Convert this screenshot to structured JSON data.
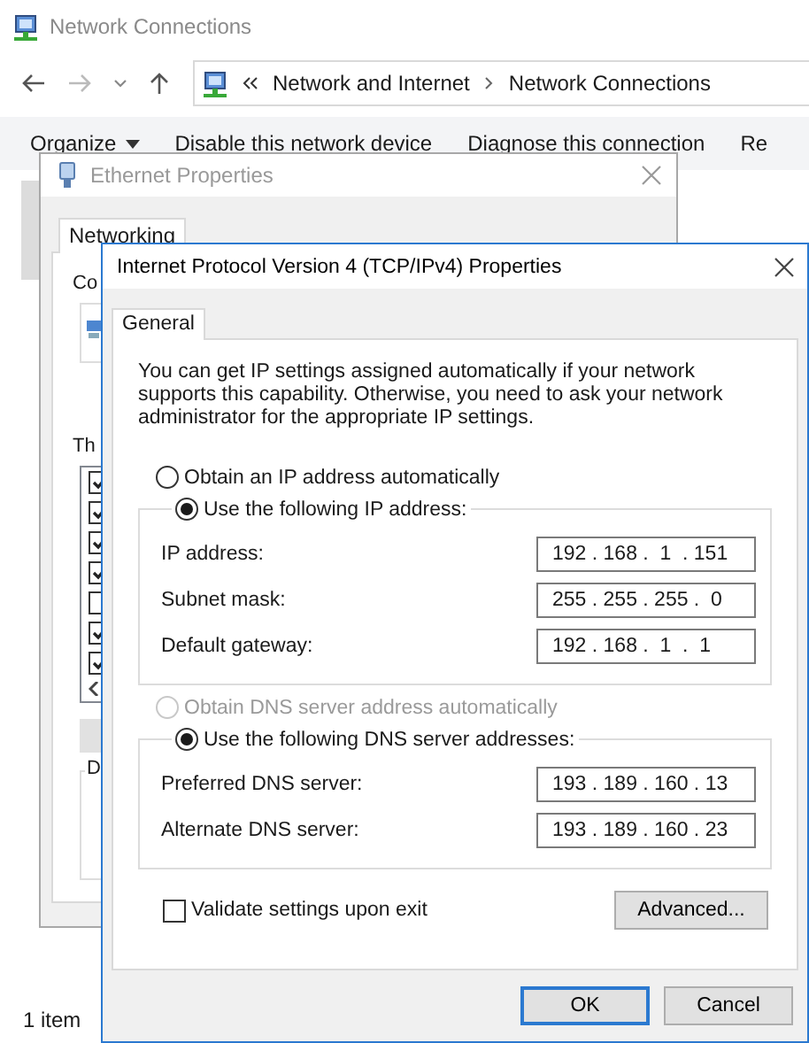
{
  "explorer": {
    "title": "Network Connections",
    "breadcrumb": [
      "Network and Internet",
      "Network Connections"
    ],
    "toolbar": [
      {
        "label": "Organize",
        "kind": "menu"
      },
      {
        "label": "Disable this network device",
        "kind": "button"
      },
      {
        "label": "Diagnose this connection",
        "kind": "button"
      },
      {
        "label": "Re",
        "kind": "button"
      }
    ],
    "status_bar": "1 item"
  },
  "ethernet_dialog": {
    "title": "Ethernet Properties",
    "tabs": [
      {
        "label": "Networking",
        "selected": true
      }
    ],
    "connect_label": "Co",
    "items_label": "Th",
    "components": [
      {
        "checked": true
      },
      {
        "checked": true
      },
      {
        "checked": true
      },
      {
        "checked": true
      },
      {
        "checked": false
      },
      {
        "checked": true
      },
      {
        "checked": true
      }
    ],
    "description_label": "D"
  },
  "ipv4_dialog": {
    "title": "Internet Protocol Version 4 (TCP/IPv4) Properties",
    "tabs": [
      {
        "label": "General",
        "selected": true
      }
    ],
    "intro": "You can get IP settings assigned automatically if your network supports this capability. Otherwise, you need to ask your network administrator for the appropriate IP settings.",
    "ip_mode": [
      {
        "label": "Obtain an IP address automatically",
        "selected": false,
        "disabled": false
      },
      {
        "label": "Use the following IP address:",
        "selected": true,
        "disabled": false
      }
    ],
    "ip_fields": [
      {
        "label": "IP address:",
        "value": "192 . 168 .  1  . 151"
      },
      {
        "label": "Subnet mask:",
        "value": "255 . 255 . 255 .  0"
      },
      {
        "label": "Default gateway:",
        "value": "192 . 168 .  1  .  1"
      }
    ],
    "dns_mode": [
      {
        "label": "Obtain DNS server address automatically",
        "selected": false,
        "disabled": true
      },
      {
        "label": "Use the following DNS server addresses:",
        "selected": true,
        "disabled": false
      }
    ],
    "dns_fields": [
      {
        "label": "Preferred DNS server:",
        "value": "193 . 189 . 160 . 13"
      },
      {
        "label": "Alternate DNS server:",
        "value": "193 . 189 . 160 . 23"
      }
    ],
    "validate": {
      "label": "Validate settings upon exit",
      "checked": false
    },
    "advanced_button": "Advanced...",
    "buttons": [
      {
        "label": "OK",
        "default": true
      },
      {
        "label": "Cancel",
        "default": false
      }
    ]
  }
}
